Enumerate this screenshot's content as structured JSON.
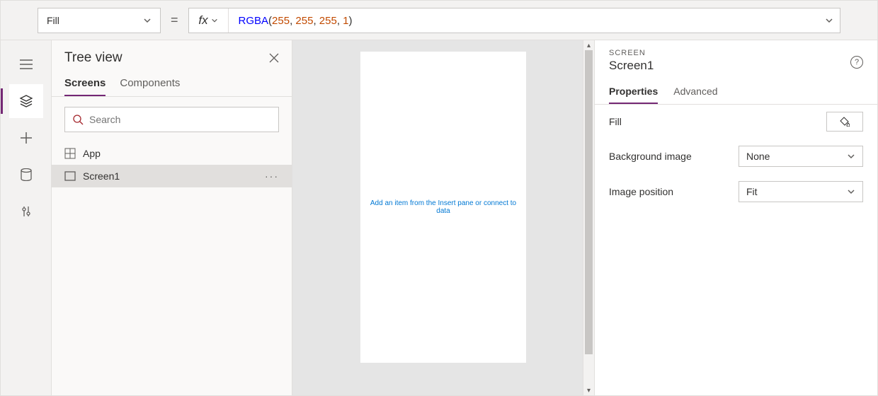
{
  "formulaBar": {
    "property": "Fill",
    "fx": "fx",
    "formula": {
      "func": "RGBA",
      "args": [
        "255",
        "255",
        "255",
        "1"
      ]
    }
  },
  "tree": {
    "title": "Tree view",
    "tabs": {
      "screens": "Screens",
      "components": "Components"
    },
    "searchPlaceholder": "Search",
    "items": {
      "app": "App",
      "screen1": "Screen1"
    }
  },
  "canvas": {
    "hint": "Add an item from the Insert pane or connect to data"
  },
  "propsPanel": {
    "typeLabel": "SCREEN",
    "name": "Screen1",
    "tabs": {
      "properties": "Properties",
      "advanced": "Advanced"
    },
    "rows": {
      "fill": {
        "label": "Fill"
      },
      "bgImage": {
        "label": "Background image",
        "value": "None"
      },
      "imgPos": {
        "label": "Image position",
        "value": "Fit"
      }
    }
  }
}
